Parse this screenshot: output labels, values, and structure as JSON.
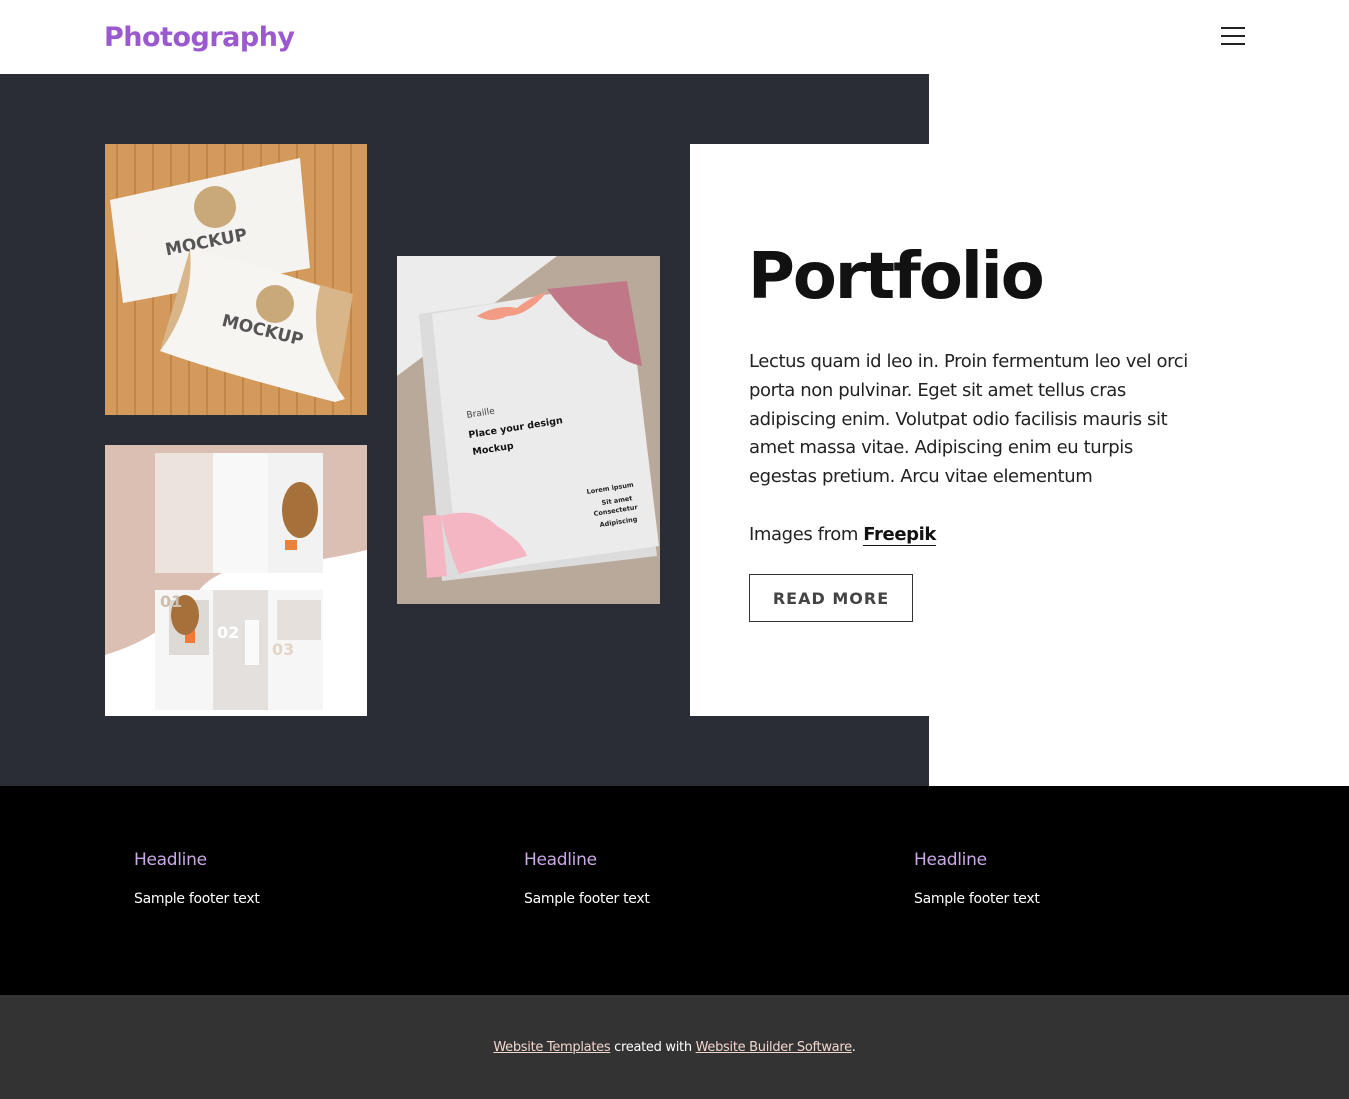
{
  "header": {
    "logo": "Photography",
    "menu_icon": "hamburger-menu-icon"
  },
  "hero": {
    "images": [
      {
        "alt": "Business card mockup on bamboo mat",
        "caption_text": "MOCKUP"
      },
      {
        "alt": "Brochure mockup - Place your design",
        "caption_text": "Place your design Mockup"
      },
      {
        "alt": "Trifold beauty brochure mockup",
        "caption_text": "01 02 03"
      }
    ],
    "title": "Portfolio",
    "body": "Lectus quam id leo in. Proin fermentum leo vel orci porta non pulvinar. Eget sit amet tellus cras adipiscing enim. Volutpat odio facilisis mauris sit amet massa vitae. Adipiscing enim eu turpis egestas pretium. Arcu vitae elementum",
    "credit_prefix": "Images from ",
    "credit_link": "Freepik",
    "button_label": "READ MORE"
  },
  "footer": {
    "columns": [
      {
        "headline": "Headline",
        "text": "Sample footer text"
      },
      {
        "headline": "Headline",
        "text": "Sample footer text"
      },
      {
        "headline": "Headline",
        "text": "Sample footer text"
      }
    ]
  },
  "bottom": {
    "link1": "Website Templates",
    "middle": " created with ",
    "link2": "Website Builder Software",
    "end": "."
  },
  "colors": {
    "brand": "#9b59d0",
    "dark_panel": "#2a2d35",
    "footer_bg": "#000000",
    "bottom_bg": "#333333",
    "headline": "#c9a9e6"
  }
}
